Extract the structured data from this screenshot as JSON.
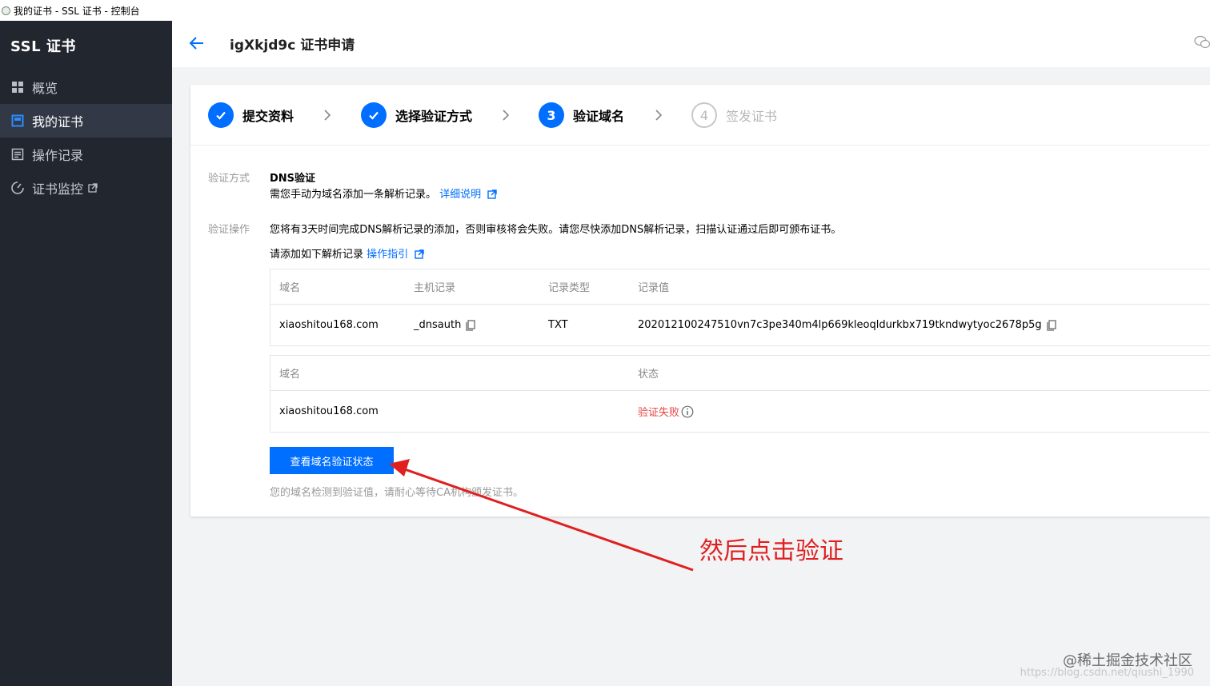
{
  "browser": {
    "tab_title": "我的证书 - SSL 证书 - 控制台"
  },
  "sidebar": {
    "brand": "SSL 证书",
    "items": [
      {
        "label": "概览",
        "icon": "grid-icon",
        "active": false
      },
      {
        "label": "我的证书",
        "icon": "certificate-icon",
        "active": true
      },
      {
        "label": "操作记录",
        "icon": "record-icon",
        "active": false
      },
      {
        "label": "证书监控",
        "icon": "monitor-icon",
        "active": false,
        "external": true
      }
    ]
  },
  "header": {
    "title": "igXkjd9c 证书申请",
    "back_icon": "arrow-left-icon",
    "chat_icon": "wechat-icon"
  },
  "steps": [
    {
      "label": "提交资料",
      "state": "done"
    },
    {
      "label": "选择验证方式",
      "state": "done"
    },
    {
      "number": "3",
      "label": "验证域名",
      "state": "current"
    },
    {
      "number": "4",
      "label": "签发证书",
      "state": "todo"
    }
  ],
  "method": {
    "label": "验证方式",
    "name": "DNS验证",
    "desc": "需您手动为域名添加一条解析记录。",
    "link": "详细说明"
  },
  "operation": {
    "label": "验证操作",
    "notice": "您将有3天时间完成DNS解析记录的添加，否则审核将会失败。请您尽快添加DNS解析记录，扫描认证通过后即可颁布证书。",
    "add_text": "请添加如下解析记录",
    "guide_link": "操作指引"
  },
  "record_table": {
    "headers": [
      "域名",
      "主机记录",
      "记录类型",
      "记录值"
    ],
    "row": {
      "domain": "xiaoshitou168.com",
      "host": "_dnsauth",
      "type": "TXT",
      "value": "202012100247510vn7c3pe340m4lp669kleoqldurkbx719tkndwytyoc2678p5g"
    }
  },
  "status_table": {
    "headers": [
      "域名",
      "状态"
    ],
    "row": {
      "domain": "xiaoshitou168.com",
      "status": "验证失败"
    }
  },
  "colors": {
    "primary": "#006eff",
    "error": "#e54545",
    "annotation": "#e02020"
  },
  "verify_button": "查看域名验证状态",
  "hint": "您的域名检测到验证值，请耐心等待CA机构颁发证书。",
  "annotation": "然后点击验证",
  "watermark": "@稀土掘金技术社区",
  "watermark_url": "https://blog.csdn.net/qiushi_1990"
}
